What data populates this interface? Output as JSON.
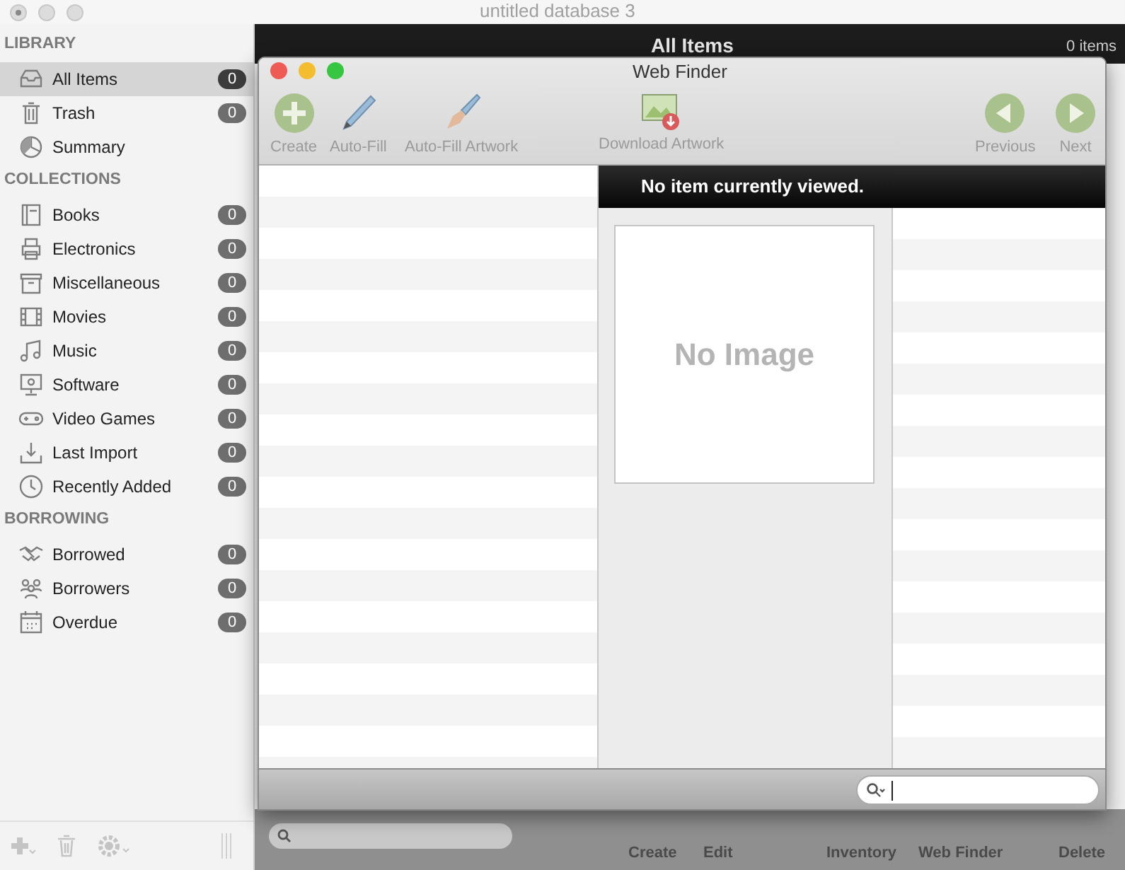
{
  "window": {
    "title": "untitled database 3"
  },
  "sidebar": {
    "sections": [
      {
        "heading": "LIBRARY",
        "items": [
          {
            "label": "All Items",
            "count": "0",
            "selected": true
          },
          {
            "label": "Trash",
            "count": "0",
            "selected": false
          },
          {
            "label": "Summary",
            "selected": false
          }
        ]
      },
      {
        "heading": "COLLECTIONS",
        "items": [
          {
            "label": "Books",
            "count": "0",
            "selected": false
          },
          {
            "label": "Electronics",
            "count": "0",
            "selected": false
          },
          {
            "label": "Miscellaneous",
            "count": "0",
            "selected": false
          },
          {
            "label": "Movies",
            "count": "0",
            "selected": false
          },
          {
            "label": "Music",
            "count": "0",
            "selected": false
          },
          {
            "label": "Software",
            "count": "0",
            "selected": false
          },
          {
            "label": "Video Games",
            "count": "0",
            "selected": false
          },
          {
            "label": "Last Import",
            "count": "0",
            "selected": false
          },
          {
            "label": "Recently Added",
            "count": "0",
            "selected": false
          }
        ]
      },
      {
        "heading": "BORROWING",
        "items": [
          {
            "label": "Borrowed",
            "count": "0",
            "selected": false
          },
          {
            "label": "Borrowers",
            "count": "0",
            "selected": false
          },
          {
            "label": "Overdue",
            "count": "0",
            "selected": false
          }
        ]
      }
    ]
  },
  "main": {
    "header_title": "All Items",
    "item_count": "0 items",
    "toolbar": [
      "Create",
      "Edit",
      "Inventory",
      "Web Finder",
      "Delete"
    ]
  },
  "web_finder": {
    "title": "Web Finder",
    "toolbar": [
      {
        "label": "Create",
        "kind": "add"
      },
      {
        "label": "Auto-Fill",
        "kind": "pen"
      },
      {
        "label": "Auto-Fill Artwork",
        "kind": "brush"
      },
      {
        "label": "Download Artwork",
        "kind": "download"
      },
      {
        "label": "Previous",
        "kind": "prev"
      },
      {
        "label": "Next",
        "kind": "next"
      }
    ],
    "status": "No item currently viewed.",
    "image_placeholder": "No Image"
  }
}
